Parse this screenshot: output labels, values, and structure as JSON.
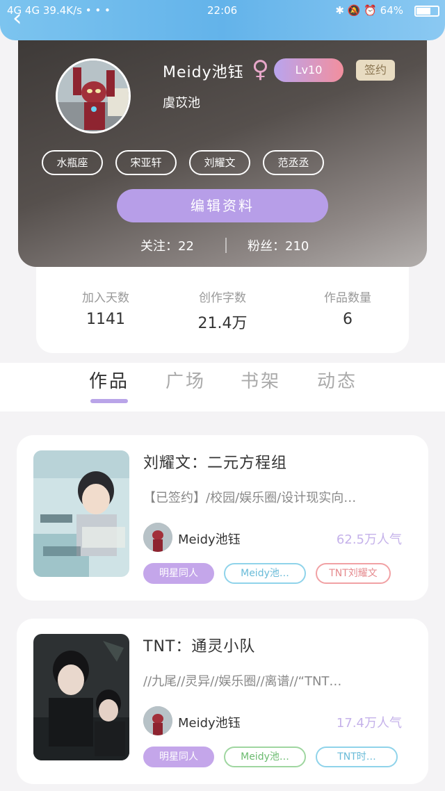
{
  "status_bar": {
    "left": "4G 4G  39.4K/s • • •",
    "time": "22:06",
    "right": "✱ 🔕 ⏰ 64%",
    "battery_level": 0.64
  },
  "header": {
    "back_icon": "chevron-left-icon",
    "back_glyph": "‹"
  },
  "profile": {
    "name": "Meidy池钰",
    "gender_symbol": "♀",
    "level": "Lv10",
    "signed_badge": "签约",
    "subname": "虞苡池",
    "tags": [
      "水瓶座",
      "宋亚轩",
      "刘耀文",
      "范丞丞"
    ],
    "edit_button": "编辑资料",
    "follow_label": "关注：",
    "follow_count": "22",
    "fans_label": "粉丝：",
    "fans_count": "210"
  },
  "stats": [
    {
      "label": "加入天数",
      "value": "1141"
    },
    {
      "label": "创作字数",
      "value": "21.4万"
    },
    {
      "label": "作品数量",
      "value": "6"
    }
  ],
  "tabs": [
    {
      "label": "作品",
      "active": true
    },
    {
      "label": "广场",
      "active": false
    },
    {
      "label": "书架",
      "active": false
    },
    {
      "label": "动态",
      "active": false
    }
  ],
  "works": [
    {
      "title": "刘耀文：二元方程组",
      "description": "【已签约】/校园/娱乐圈/设计现实向…",
      "author": "Meidy池钰",
      "popularity": "62.5万人气",
      "tags": [
        {
          "text": "明星同人",
          "style": "purple"
        },
        {
          "text": "Meidy池…",
          "style": "blue"
        },
        {
          "text": "TNT刘耀文",
          "style": "red"
        }
      ]
    },
    {
      "title": "TNT：通灵小队",
      "description": "//九尾//灵异//娱乐圈//离谱//“TNT…",
      "author": "Meidy池钰",
      "popularity": "17.4万人气",
      "tags": [
        {
          "text": "明星同人",
          "style": "purple"
        },
        {
          "text": "Meidy池…",
          "style": "green"
        },
        {
          "text": "TNT时…",
          "style": "blue"
        }
      ]
    }
  ],
  "colors": {
    "accent_purple": "#b79ee8",
    "top_blue": "#63b3ea",
    "popularity": "#c5b2ea"
  }
}
